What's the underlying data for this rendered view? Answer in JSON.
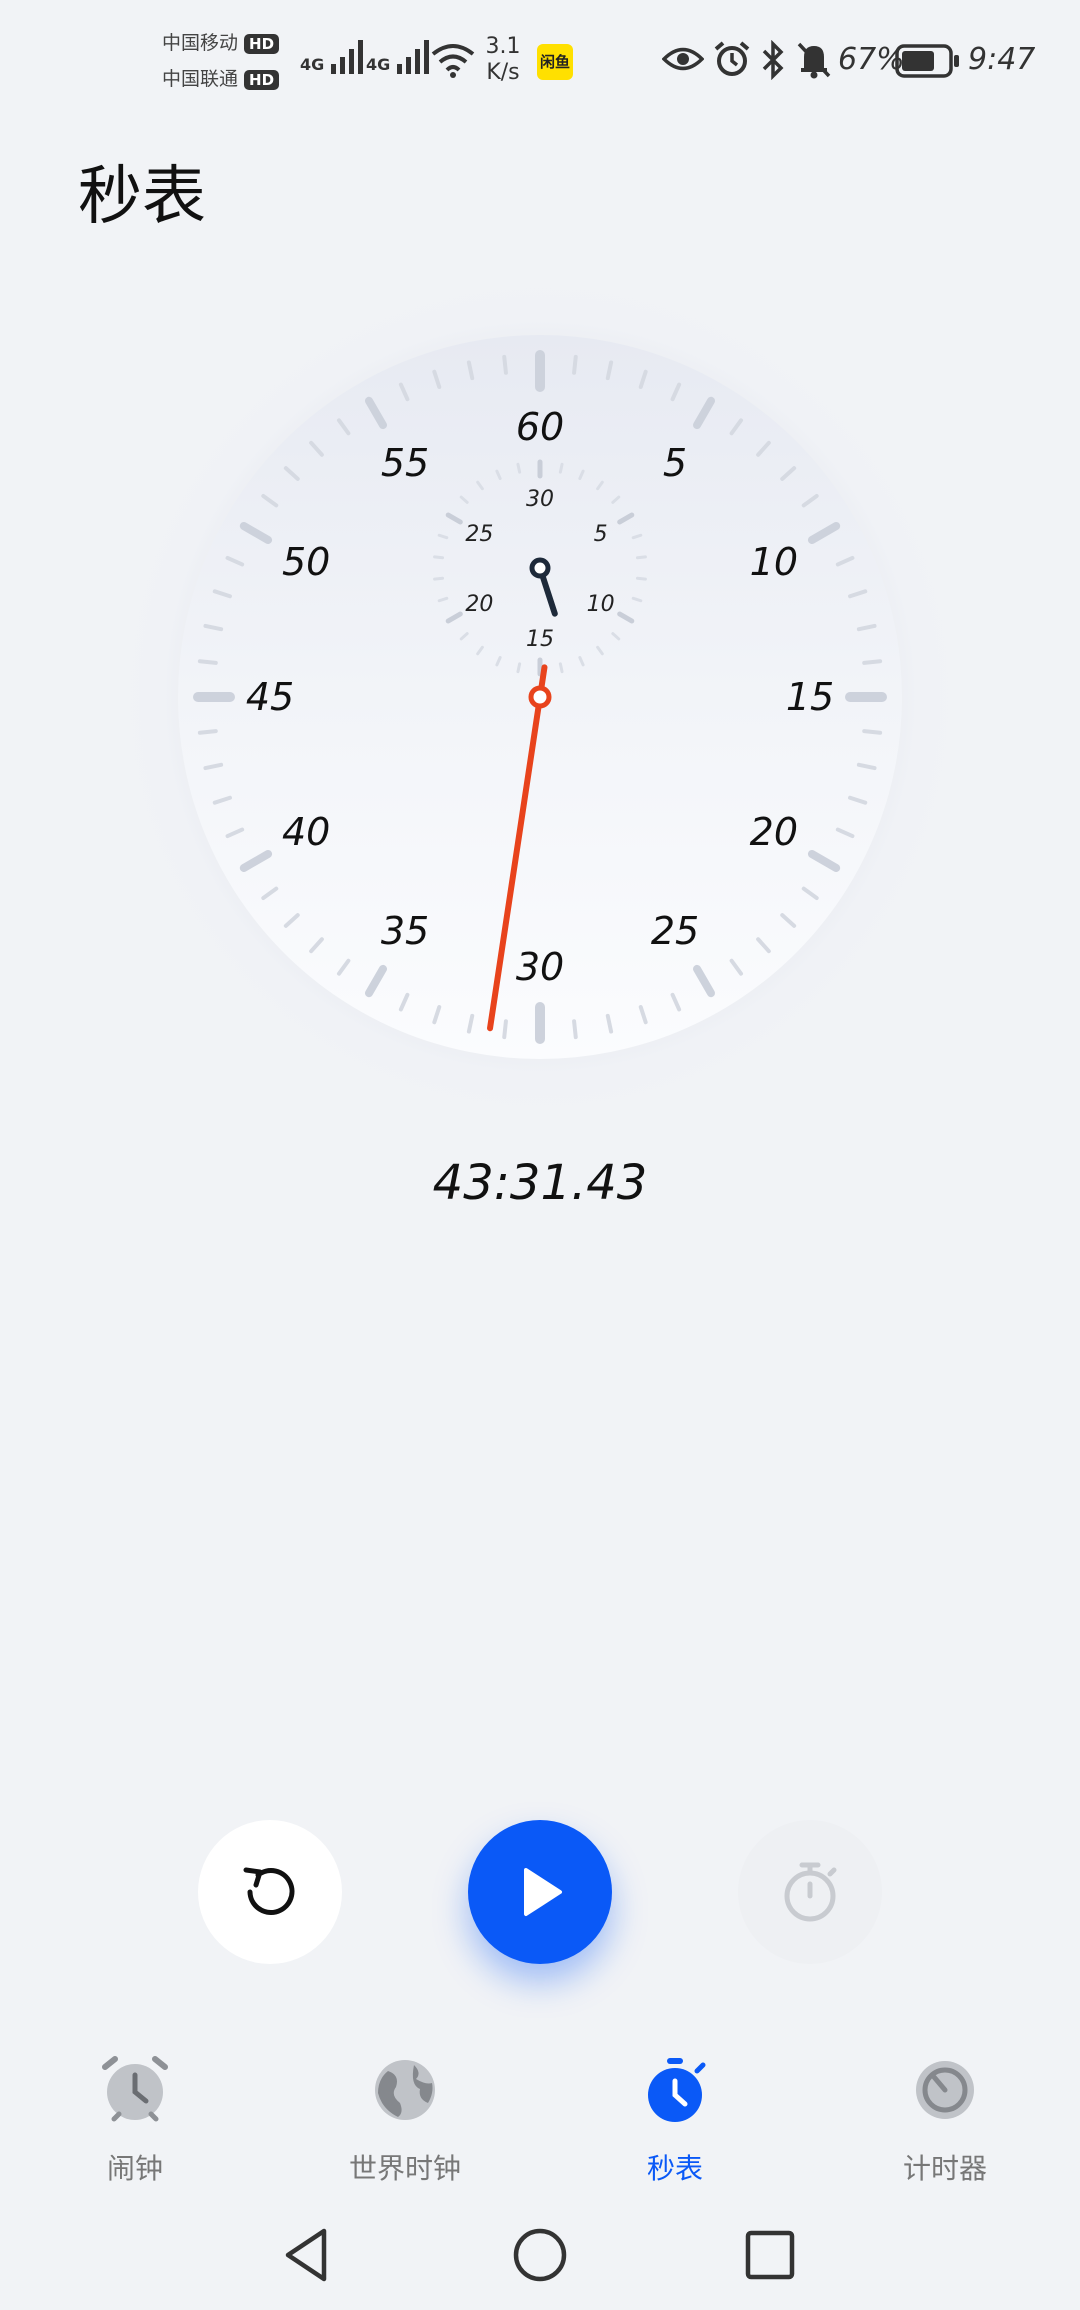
{
  "status_bar": {
    "carrier1": "中国移动",
    "carrier2": "中国联通",
    "hd": "HD",
    "net1": "4G",
    "net2": "4G",
    "speed_value": "3.1",
    "speed_unit": "K/s",
    "app_badge": "闲鱼",
    "battery_percent": "67%",
    "time": "9:47",
    "icons": [
      "eye-icon",
      "alarm-icon",
      "bluetooth-icon",
      "bell-off-icon",
      "battery-icon"
    ]
  },
  "header": {
    "title": "秒表"
  },
  "stopwatch": {
    "outer_labels": [
      "60",
      "5",
      "10",
      "15",
      "20",
      "25",
      "30",
      "35",
      "40",
      "45",
      "50",
      "55"
    ],
    "inner_labels": [
      "30",
      "5",
      "10",
      "15",
      "20",
      "25"
    ],
    "elapsed": "43:31.43",
    "second_hand_seconds": 31.43,
    "minute_hand_minutes": 13.5
  },
  "colors": {
    "accent": "#0a59f7",
    "second_hand": "#e8431c",
    "background": "#f1f3f6"
  },
  "controls": {
    "reset": "reset-icon",
    "start": "play-icon",
    "lap": "stopwatch-icon"
  },
  "tabs": [
    {
      "label": "闹钟",
      "icon": "alarm-clock-icon",
      "active": false
    },
    {
      "label": "世界时钟",
      "icon": "globe-icon",
      "active": false
    },
    {
      "label": "秒表",
      "icon": "stopwatch-icon",
      "active": true
    },
    {
      "label": "计时器",
      "icon": "timer-icon",
      "active": false
    }
  ],
  "nav_bar": [
    "back-icon",
    "home-icon",
    "recents-icon"
  ]
}
